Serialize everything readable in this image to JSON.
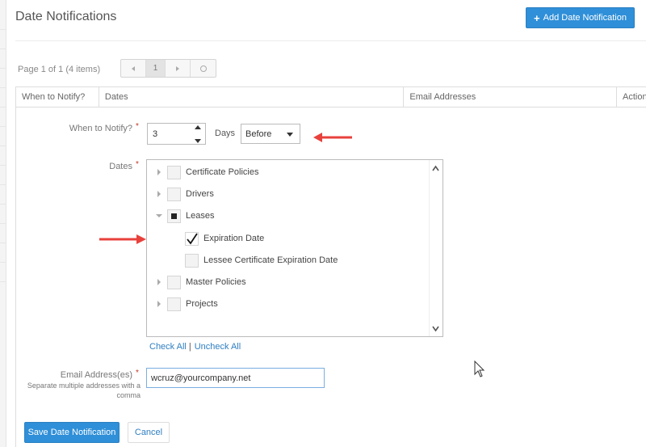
{
  "page": {
    "title": "Date Notifications",
    "add_button_label": "Add Date Notification"
  },
  "pager": {
    "summary": "Page 1 of 1 (4 items)",
    "current_page": "1"
  },
  "grid": {
    "columns": [
      "When to Notify?",
      "Dates",
      "Email Addresses",
      "Actions"
    ]
  },
  "form": {
    "when_label": "When to Notify?",
    "when_value": "3",
    "days_label": "Days",
    "timing_value": "Before",
    "dates_label": "Dates",
    "tree": [
      {
        "label": "Certificate Policies",
        "expanded": false,
        "state": "unchecked"
      },
      {
        "label": "Drivers",
        "expanded": false,
        "state": "unchecked"
      },
      {
        "label": "Leases",
        "expanded": true,
        "state": "partial",
        "children": [
          {
            "label": "Expiration Date",
            "state": "checked"
          },
          {
            "label": "Lessee Certificate Expiration Date",
            "state": "unchecked"
          }
        ]
      },
      {
        "label": "Master Policies",
        "expanded": false,
        "state": "unchecked"
      },
      {
        "label": "Projects",
        "expanded": false,
        "state": "unchecked"
      }
    ],
    "check_all_label": "Check All",
    "uncheck_all_label": "Uncheck All",
    "email_label": "Email Address(es)",
    "email_hint": "Separate multiple addresses with a comma",
    "email_value": "wcruz@yourcompany.net",
    "required_mark": "*"
  },
  "actions": {
    "save_label": "Save Date Notification",
    "cancel_label": "Cancel"
  },
  "colors": {
    "primary": "#2f8fd8",
    "link": "#2f7fc1",
    "arrow": "#e8413c",
    "required": "#c0392b"
  },
  "icons": {
    "add": "plus-icon",
    "spinner_up": "caret-up-icon",
    "spinner_down": "caret-down-icon",
    "select": "caret-down-icon",
    "tree_collapsed": "triangle-right-icon",
    "tree_expanded": "triangle-down-icon",
    "scroll_up": "chevron-up-icon",
    "scroll_down": "chevron-down-icon"
  }
}
